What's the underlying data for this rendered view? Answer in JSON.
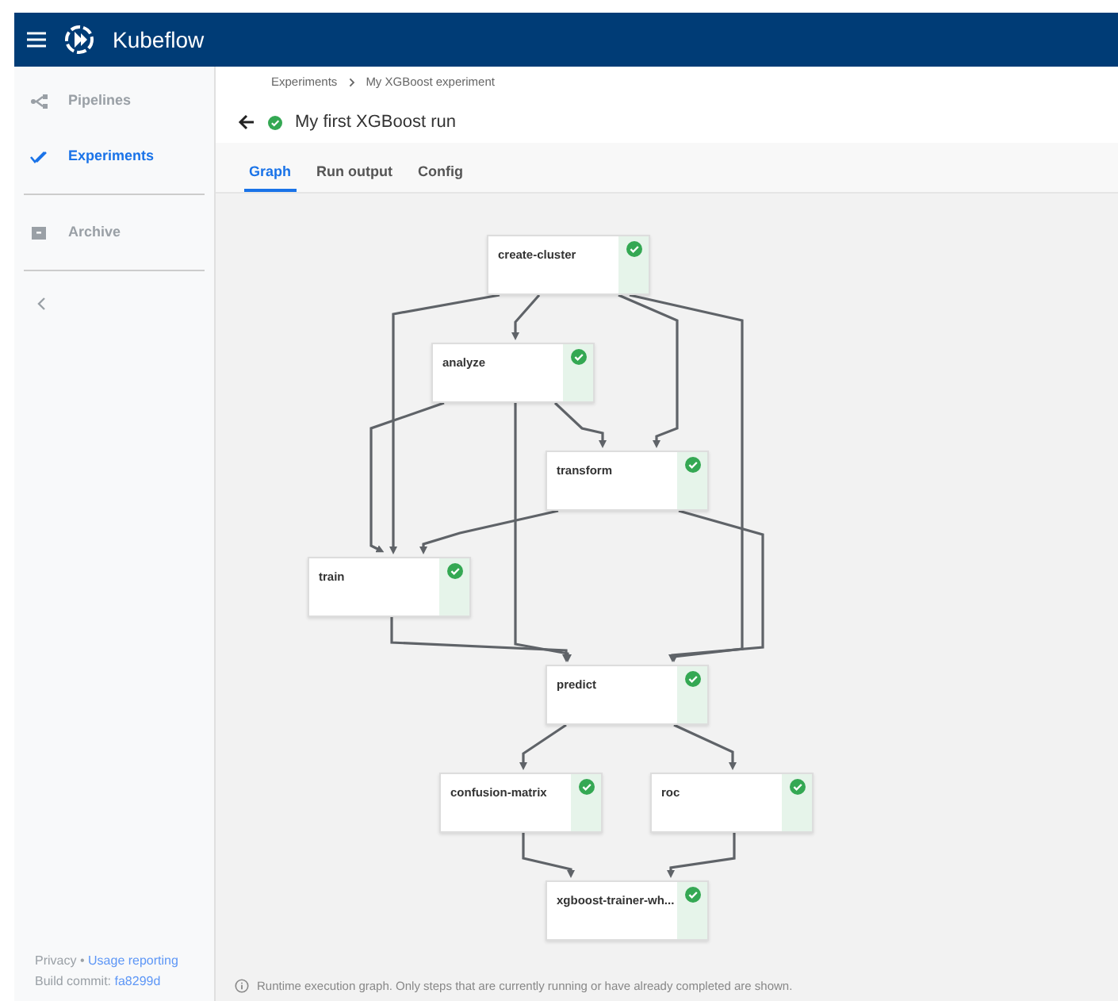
{
  "app_bar": {
    "title": "Kubeflow"
  },
  "sidebar": {
    "items": [
      {
        "label": "Pipelines",
        "selected": false
      },
      {
        "label": "Experiments",
        "selected": true
      },
      {
        "label": "Archive",
        "selected": false
      }
    ],
    "footer": {
      "privacy": "Privacy",
      "separator": "•",
      "usage": "Usage reporting",
      "build_label": "Build commit:",
      "build_hash": "fa8299d"
    }
  },
  "breadcrumbs": [
    "Experiments",
    "My XGBoost experiment"
  ],
  "run": {
    "title": "My first XGBoost run",
    "succeeded": true
  },
  "tabs": [
    {
      "label": "Graph",
      "selected": true
    },
    {
      "label": "Run output",
      "selected": false
    },
    {
      "label": "Config",
      "selected": false
    }
  ],
  "graph": {
    "nodes": [
      {
        "name": "create-cluster",
        "succeeded": true
      },
      {
        "name": "analyze",
        "succeeded": true
      },
      {
        "name": "transform",
        "succeeded": true
      },
      {
        "name": "train",
        "succeeded": true
      },
      {
        "name": "predict",
        "succeeded": true
      },
      {
        "name": "confusion-matrix",
        "succeeded": true
      },
      {
        "name": "roc",
        "succeeded": true
      },
      {
        "name": "xgboost-trainer-wh...",
        "succeeded": true
      }
    ]
  },
  "info_note": "Runtime execution graph. Only steps that are currently running or have already completed are shown."
}
